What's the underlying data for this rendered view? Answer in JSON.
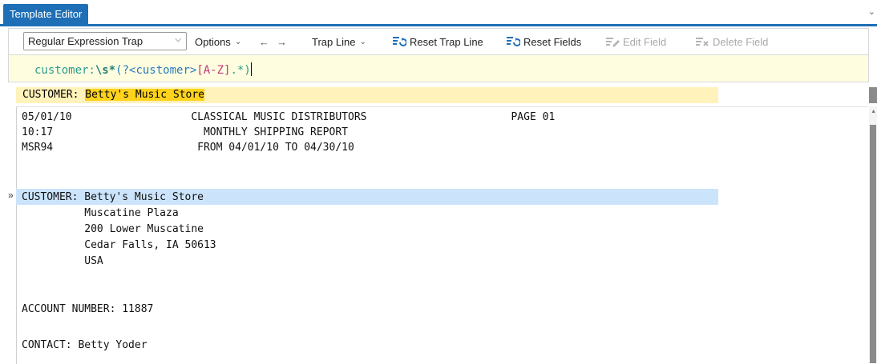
{
  "tab": {
    "title": "Template Editor"
  },
  "toolbar": {
    "trap_type": "Regular Expression Trap",
    "options": "Options",
    "back": "←",
    "forward": "→",
    "trap_line": "Trap Line",
    "reset_trap_line": "Reset Trap Line",
    "reset_fields": "Reset Fields",
    "edit_field": "Edit Field",
    "delete_field": "Delete Field"
  },
  "regex": {
    "p1": "customer:",
    "p2": "\\s*",
    "p3": "(?<customer>",
    "p4": "[A-Z]",
    "p5": ".*)"
  },
  "match": {
    "prefix": "CUSTOMER: ",
    "value": "Betty's Music Store"
  },
  "report": {
    "lines": [
      "05/01/10                   CLASSICAL MUSIC DISTRIBUTORS                       PAGE 01",
      "10:17                        MONTHLY SHIPPING REPORT",
      "MSR94                       FROM 04/01/10 TO 04/30/10",
      "",
      "",
      "CUSTOMER: Betty's Music Store",
      "          Muscatine Plaza",
      "          200 Lower Muscatine",
      "          Cedar Falls, IA 50613",
      "          USA",
      "",
      "",
      "ACCOUNT NUMBER: 11887",
      "",
      "CONTACT: Betty Yoder"
    ],
    "marker": "»"
  },
  "colors": {
    "tab_blue": "#1f6fb6",
    "regex_bg": "#fffde0",
    "match_row": "#fff2ba",
    "match_hl": "#ffd21c",
    "selected_row": "#cce4fb"
  }
}
